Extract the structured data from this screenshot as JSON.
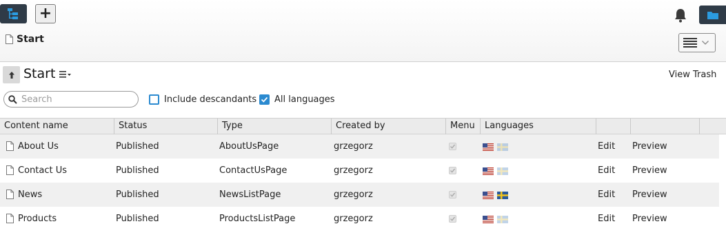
{
  "toolbar": {
    "tree_icon": "tree-icon",
    "add_icon": "plus-icon",
    "add_label": "+",
    "bell_icon": "bell-icon",
    "folder_icon": "folder-icon"
  },
  "breadcrumb": {
    "label": "Start"
  },
  "view_toggle": {
    "icon": "list-view-icon"
  },
  "page": {
    "title": "Start",
    "view_trash": "View Trash"
  },
  "search": {
    "placeholder": "Search",
    "value": ""
  },
  "filters": {
    "include_descendants": {
      "label": "Include descandants",
      "checked": false
    },
    "all_languages": {
      "label": "All languages",
      "checked": true
    }
  },
  "grid": {
    "columns": [
      "Content name",
      "Status",
      "Type",
      "Created by",
      "Menu",
      "Languages",
      "",
      "",
      ""
    ],
    "rows": [
      {
        "name": "About Us",
        "status": "Published",
        "type": "AboutUsPage",
        "created_by": "grzegorz",
        "menu": true,
        "sv_active": false,
        "edit": "Edit",
        "preview": "Preview"
      },
      {
        "name": "Contact Us",
        "status": "Published",
        "type": "ContactUsPage",
        "created_by": "grzegorz",
        "menu": true,
        "sv_active": false,
        "edit": "Edit",
        "preview": "Preview"
      },
      {
        "name": "News",
        "status": "Published",
        "type": "NewsListPage",
        "created_by": "grzegorz",
        "menu": true,
        "sv_active": true,
        "edit": "Edit",
        "preview": "Preview"
      },
      {
        "name": "Products",
        "status": "Published",
        "type": "ProductsListPage",
        "created_by": "grzegorz",
        "menu": true,
        "sv_active": false,
        "edit": "Edit",
        "preview": "Preview"
      }
    ]
  },
  "colors": {
    "toolbar_dark": "#2f3b47",
    "accent_blue": "#2b8ad0",
    "row_alt": "#f0f0f0"
  }
}
